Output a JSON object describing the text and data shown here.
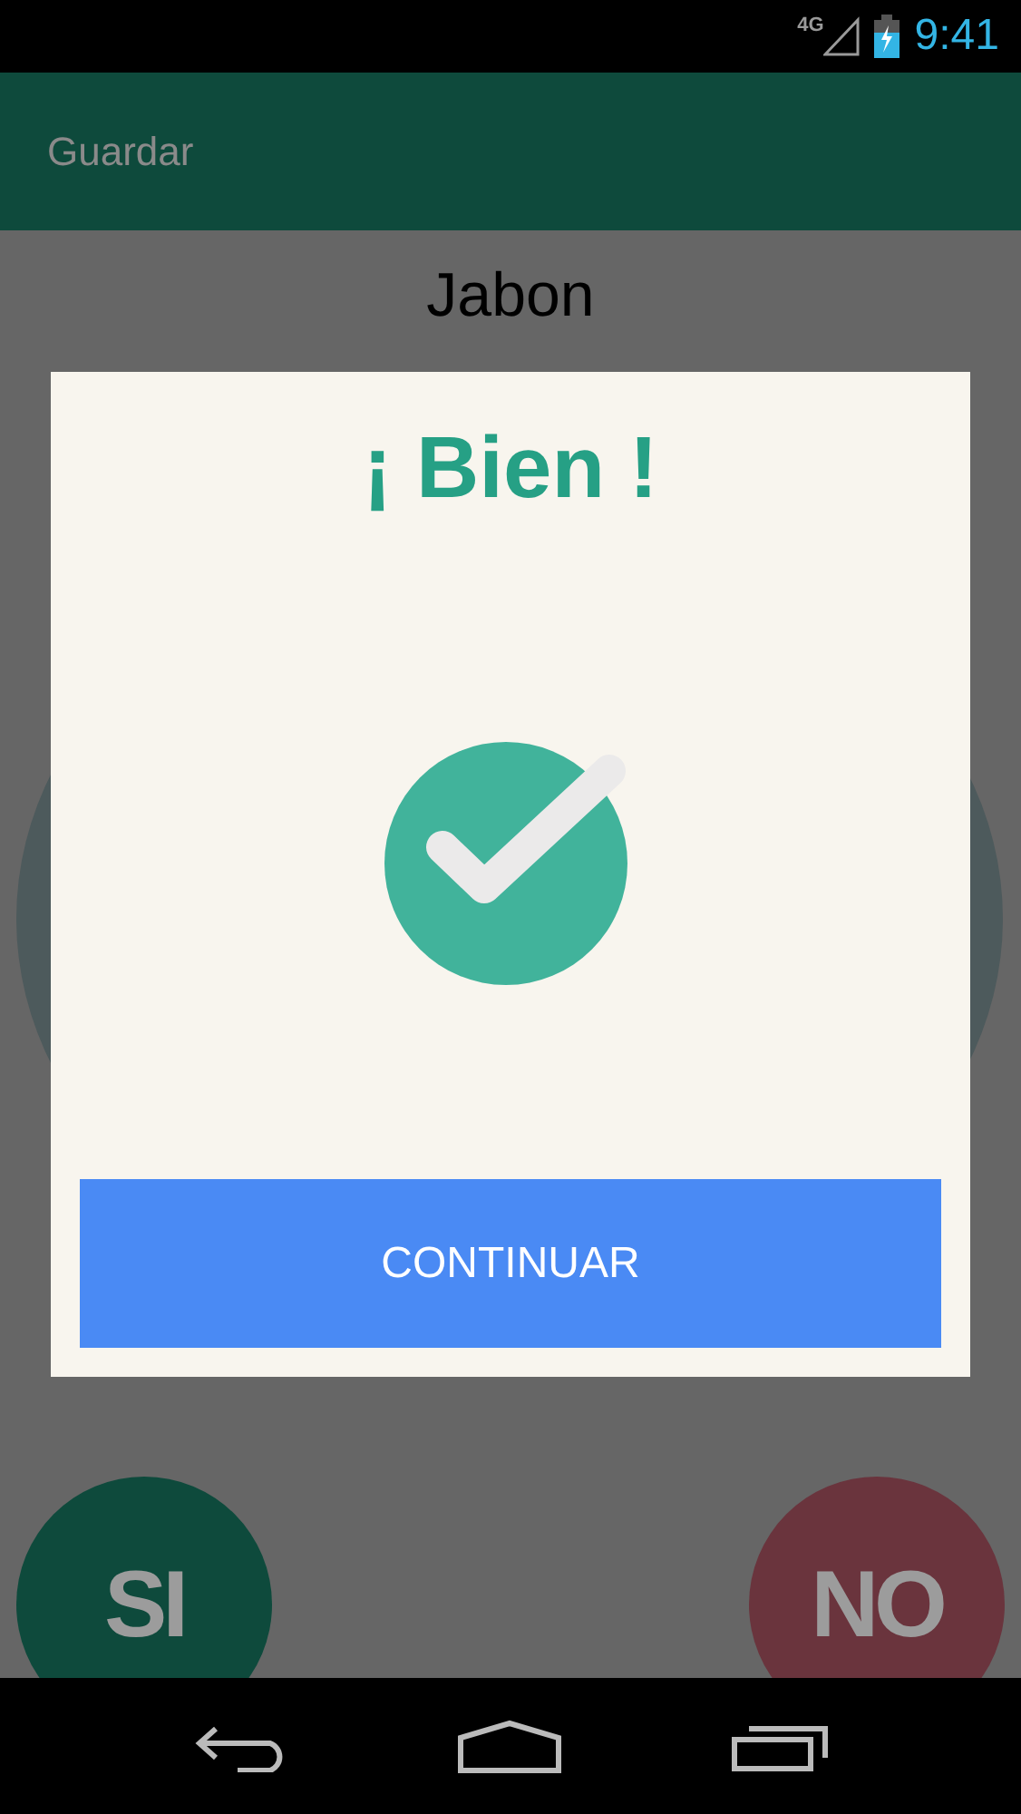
{
  "status_bar": {
    "network": "4G",
    "time": "9:41"
  },
  "app_bar": {
    "title": "Guardar"
  },
  "screen": {
    "title": "Jabon",
    "answer_buttons": [
      {
        "label": "SI",
        "kind": "yes"
      },
      {
        "label": "NO",
        "kind": "no"
      }
    ]
  },
  "dialog": {
    "title": "¡ Bien !",
    "button": "CONTINUAR"
  }
}
